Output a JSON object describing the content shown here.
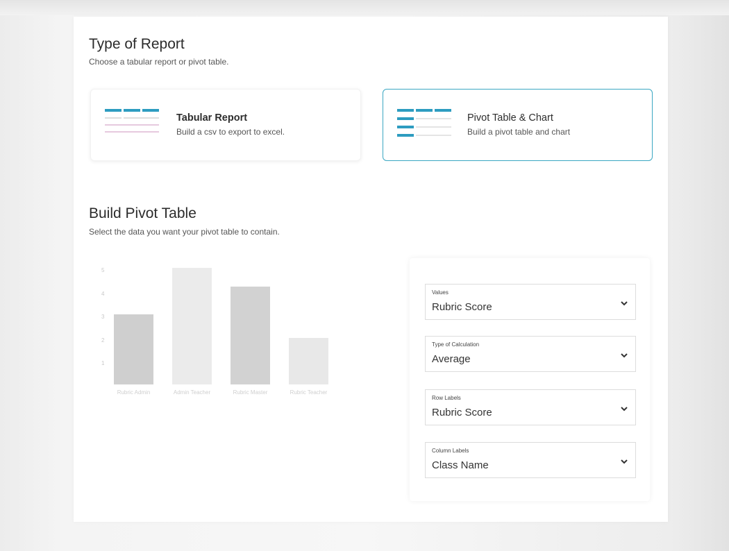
{
  "type_of_report": {
    "title": "Type of Report",
    "subtitle": "Choose a tabular report or pivot table."
  },
  "options": [
    {
      "title": "Tabular Report",
      "description": "Build a csv to export to excel.",
      "selected": false
    },
    {
      "title": "Pivot Table & Chart",
      "description": "Build a pivot table and chart",
      "selected": true
    }
  ],
  "build_pivot": {
    "title": "Build Pivot Table",
    "subtitle": "Select the data you want your pivot table to contain."
  },
  "chart_data": {
    "type": "bar",
    "categories": [
      "Rubric Admin",
      "Admin Teacher",
      "Rubric Master",
      "Rubric Teacher"
    ],
    "values": [
      3,
      5,
      4.2,
      2
    ],
    "ylim": [
      0,
      5
    ],
    "yticks": [
      "5",
      "4",
      "3",
      "2",
      "1"
    ],
    "grid": false
  },
  "fields": [
    {
      "label": "Values",
      "value": "Rubric Score"
    },
    {
      "label": "Type of Calculation",
      "value": "Average"
    },
    {
      "label": "Row Labels",
      "value": "Rubric Score"
    },
    {
      "label": "Column Labels",
      "value": "Class Name"
    }
  ],
  "colors": {
    "accent": "#3aa7c2",
    "selected_border": "#3aa7c2",
    "bar": "#cfcfcf"
  }
}
